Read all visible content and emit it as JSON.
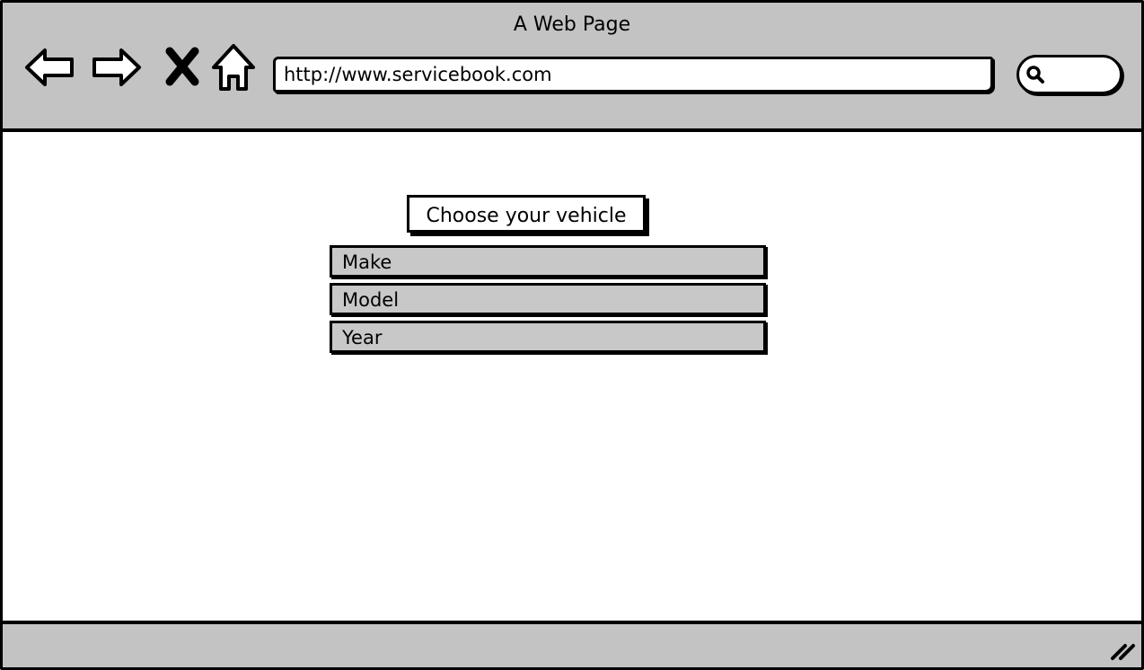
{
  "window": {
    "title": "A Web Page"
  },
  "toolbar": {
    "icons": [
      "back-arrow-icon",
      "forward-arrow-icon",
      "stop-icon",
      "home-icon"
    ],
    "address": "http://www.servicebook.com",
    "search_icon": "search-icon"
  },
  "main": {
    "heading": "Choose your vehicle",
    "fields": [
      {
        "label": "Make"
      },
      {
        "label": "Model"
      },
      {
        "label": "Year"
      }
    ]
  },
  "statusbar": {
    "grip_icon": "resize-grip-icon"
  },
  "colors": {
    "chrome": "#c3c3c3",
    "field_fill": "#c8c8c8",
    "outline": "#000000"
  }
}
